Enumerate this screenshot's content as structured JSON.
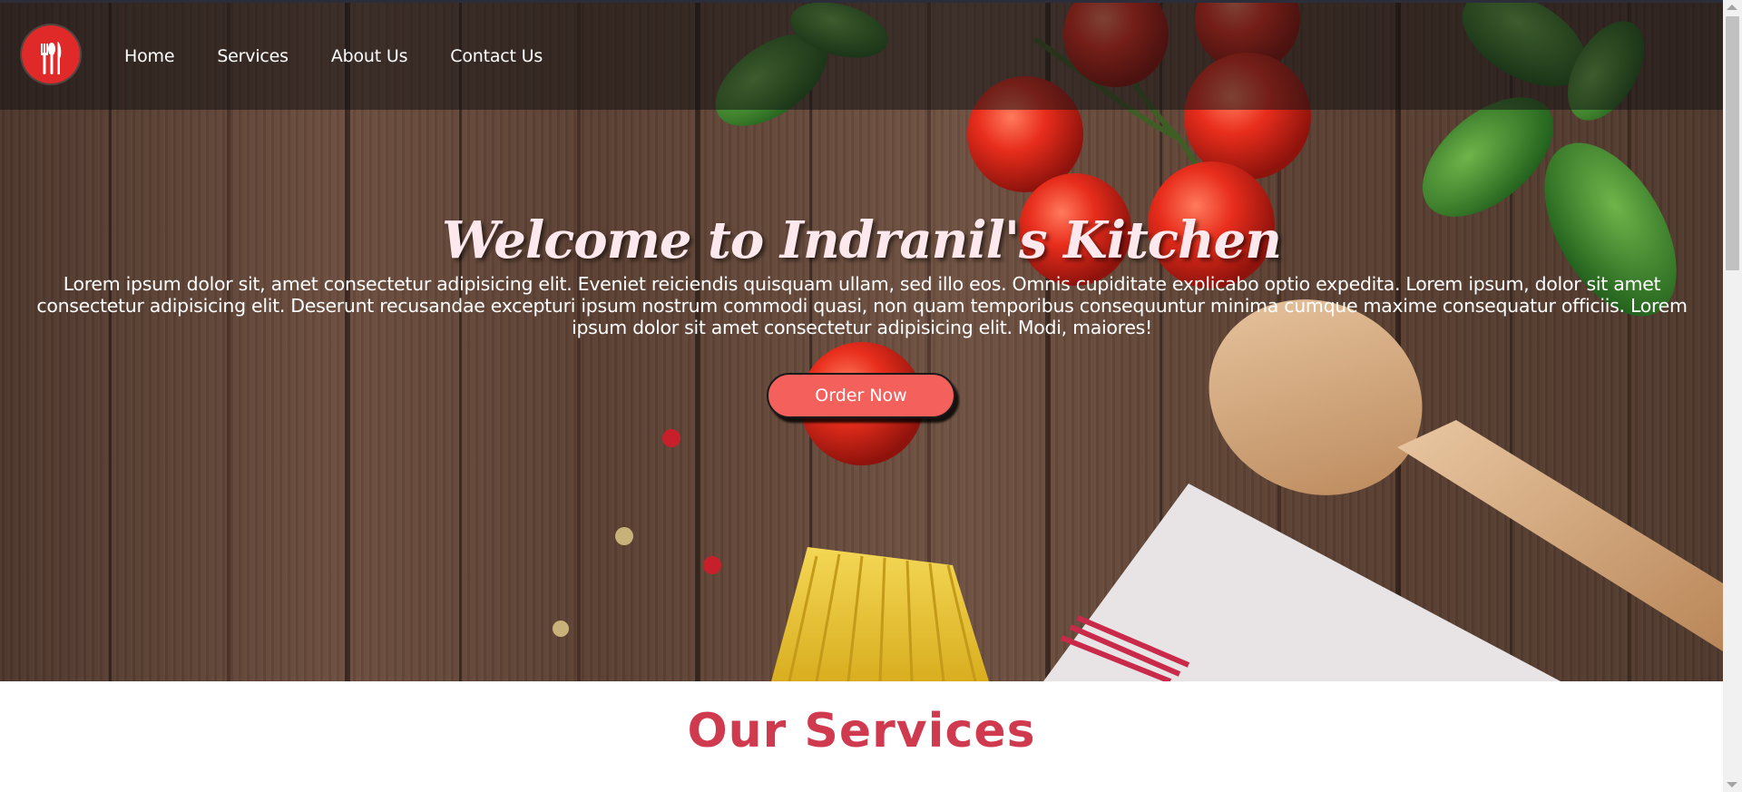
{
  "nav": {
    "logo_icon": "restaurant-cutlery-icon",
    "links": [
      "Home",
      "Services",
      "About Us",
      "Contact Us"
    ]
  },
  "hero": {
    "title": "Welcome to Indranil's Kitchen",
    "paragraph": "Lorem ipsum dolor sit, amet consectetur adipisicing elit. Eveniet reiciendis quisquam ullam, sed illo eos. Omnis cupiditate explicabo optio expedita. Lorem ipsum, dolor sit amet consectetur adipisicing elit. Deserunt recusandae excepturi ipsum nostrum commodi quasi, non quam temporibus consequuntur minima cumque maxime consequatur officiis. Lorem ipsum dolor sit amet consectetur adipisicing elit. Modi, maiores!",
    "button_label": "Order Now"
  },
  "services": {
    "title": "Our Services"
  },
  "colors": {
    "accent": "#f4605c",
    "section_title": "#d03a4f",
    "logo_red": "#e02a2a",
    "hero_title": "#fde8ee"
  }
}
